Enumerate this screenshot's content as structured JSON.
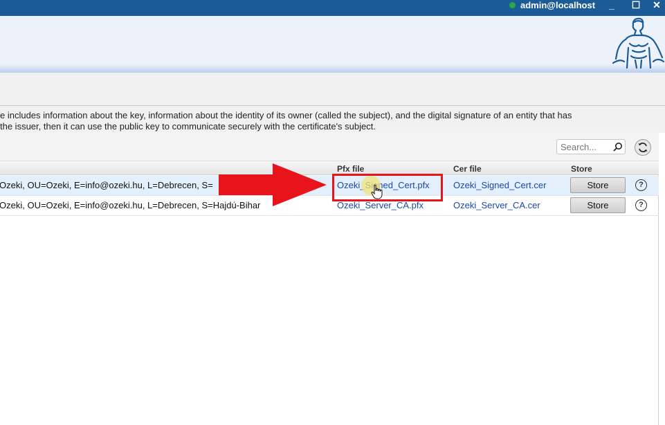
{
  "titlebar": {
    "user": "admin@localhost",
    "status_color": "#28a745",
    "minimize_glyph": "_",
    "maximize_glyph": "☐",
    "close_glyph": "✕"
  },
  "description": {
    "line1": "e includes information about the key, information about the identity of its owner (called the subject), and the digital signature of an entity that has",
    "line2": " the issuer, then it can use the public key to communicate securely with the certificate's subject."
  },
  "search": {
    "placeholder": "Search..."
  },
  "table": {
    "columns": {
      "pfx": "Pfx file",
      "cer": "Cer file",
      "store": "Store"
    },
    "rows": [
      {
        "subject": "Ozeki, OU=Ozeki, E=info@ozeki.hu, L=Debrecen, S=",
        "pfx": "Ozeki_Signed_Cert.pfx",
        "cer": "Ozeki_Signed_Cert.cer",
        "store": "Store",
        "help": "?"
      },
      {
        "subject": "Ozeki, OU=Ozeki, E=info@ozeki.hu, L=Debrecen, S=Hajdú-Bihar",
        "pfx": "Ozeki_Server_CA.pfx",
        "cer": "Ozeki_Server_CA.cer",
        "store": "Store",
        "help": "?"
      }
    ]
  },
  "annotation": {
    "arrow_color": "#e8141b",
    "box_color": "#e8141b"
  }
}
